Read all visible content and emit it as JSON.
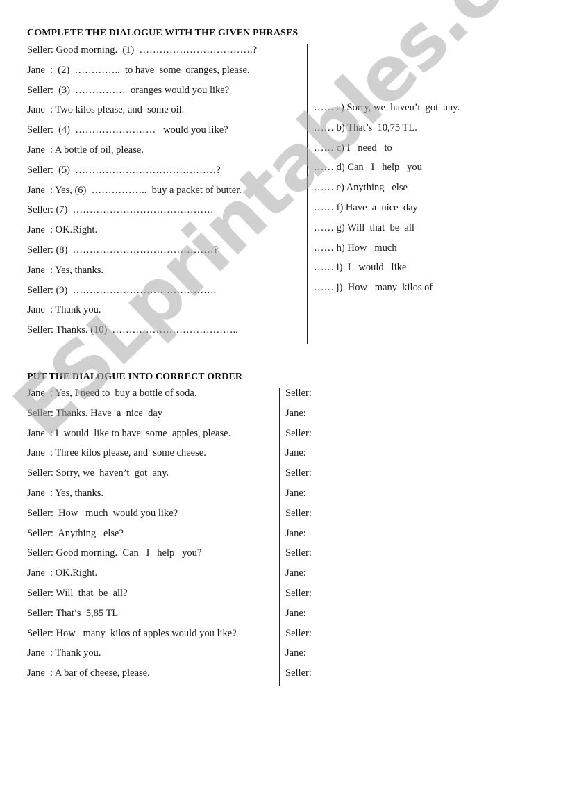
{
  "section1": {
    "heading": "COMPLETE THE DIALOGUE WITH THE GIVEN PHRASES",
    "dialogue": [
      "Seller: Good morning.  (1)  …………………………….?",
      "Jane  :  (2)  …………..  to have  some  oranges, please.",
      "Seller:  (3)  ……………  oranges would you like?",
      "Jane  : Two kilos please, and  some oil.",
      "Seller:  (4)  ……………………   would you like?",
      "Jane  : A bottle of oil, please.",
      "Seller:  (5)  ……………………………………?",
      "Jane  : Yes, (6)  ……………..  buy a packet of butter.",
      "Seller: (7)  ……………………………………",
      "Jane  : OK.Right.",
      "Seller: (8)  ……………………………………?",
      "Jane  : Yes, thanks.",
      "Seller: (9)  …………………………………….",
      "Jane  : Thank you.",
      "Seller: Thanks. (10)  ……………………………….."
    ],
    "phrases": [
      "…… a) Sorry, we  haven’t  got  any.",
      "…… b) That’s  10,75 TL.",
      "…… c) I   need   to",
      "…… d) Can   I   help   you",
      "…… e) Anything   else",
      "…… f) Have  a  nice  day",
      "…… g) Will  that  be  all",
      "…… h) How   much",
      "…… i)  I   would   like",
      "…… j)  How   many  kilos of"
    ]
  },
  "section2": {
    "heading": "PUT THE DIALOGUE INTO CORRECT ORDER",
    "lines": [
      "Jane  : Yes, I need to  buy a bottle of soda.",
      "Seller: Thanks. Have  a  nice  day",
      "Jane  : I  would  like to have  some  apples, please.",
      "Jane  : Three kilos please, and  some cheese.",
      "Seller: Sorry, we  haven’t  got  any.",
      "Jane  : Yes, thanks.",
      "Seller:  How   much  would you like?",
      "Seller:  Anything   else?",
      "Seller: Good morning.  Can   I   help   you?",
      "Jane  : OK.Right.",
      "Seller: Will  that  be  all?",
      "Seller: That’s  5,85 TL",
      "Seller: How   many  kilos of apples would you like?",
      "Jane  : Thank you.",
      "Jane  : A bar of cheese, please."
    ],
    "answer_speakers": [
      "Seller:",
      "Jane:",
      "Seller:",
      "Jane:",
      "Seller:",
      "Jane:",
      "Seller:",
      "Jane:",
      "Seller:",
      "Jane:",
      "Seller:",
      "Jane:",
      "Seller:",
      "Jane:",
      "Seller:"
    ]
  },
  "watermark": "ESLprintables.com"
}
